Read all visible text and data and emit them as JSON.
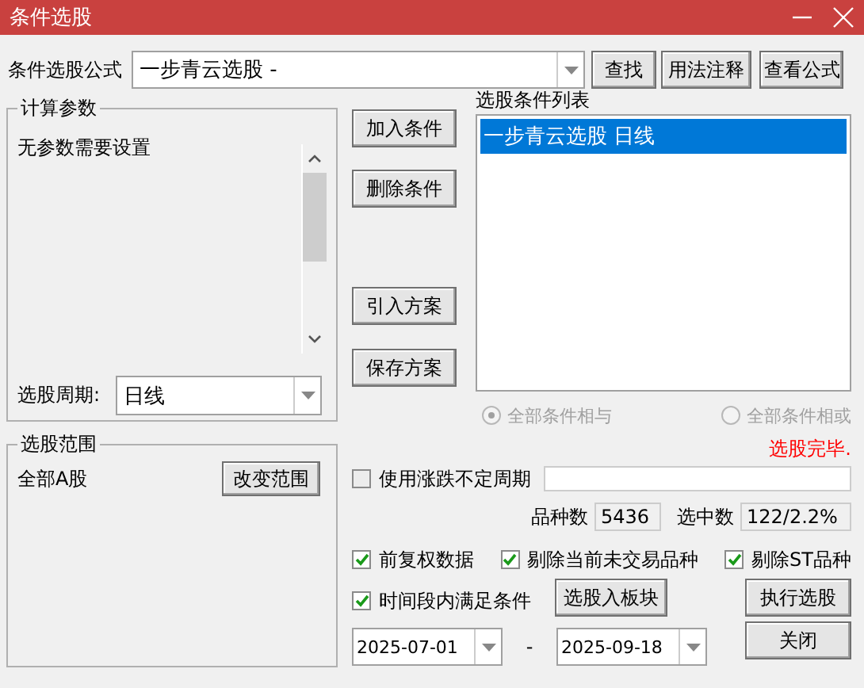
{
  "window": {
    "title": "条件选股"
  },
  "formula": {
    "label": "条件选股公式",
    "value": "一步青云选股  -"
  },
  "top_buttons": [
    "查找",
    "用法注释",
    "查看公式"
  ],
  "params_group": {
    "title": "计算参数",
    "message": "无参数需要设置",
    "period_label": "选股周期:",
    "period_value": "日线"
  },
  "action_buttons": [
    "加入条件",
    "删除条件",
    "引入方案",
    "保存方案"
  ],
  "condition_list": {
    "title": "选股条件列表",
    "items": [
      {
        "text": "一步青云选股  日线",
        "selected": true
      }
    ]
  },
  "logic_options": [
    {
      "label": "全部条件相与",
      "selected": true,
      "disabled": true
    },
    {
      "label": "全部条件相或",
      "selected": false,
      "disabled": true
    }
  ],
  "status": "选股完毕.",
  "scope_group": {
    "title": "选股范围",
    "value": "全部A股",
    "button": "改变范围"
  },
  "variable_period": {
    "label": "使用涨跌不定周期",
    "checked": false
  },
  "stats": [
    {
      "label": "品种数",
      "value": "5436"
    },
    {
      "label": "选中数",
      "value": "122/2.2%"
    }
  ],
  "options": [
    {
      "label": "前复权数据",
      "checked": true
    },
    {
      "label": "剔除当前未交易品种",
      "checked": true
    },
    {
      "label": "剔除ST品种",
      "checked": true
    }
  ],
  "time_range": {
    "label": "时间段内满足条件",
    "checked": true,
    "start": "2025-07-01",
    "separator": "-",
    "end": "2025-09-18"
  },
  "bottom_buttons": [
    "选股入板块",
    "执行选股",
    "关闭"
  ]
}
